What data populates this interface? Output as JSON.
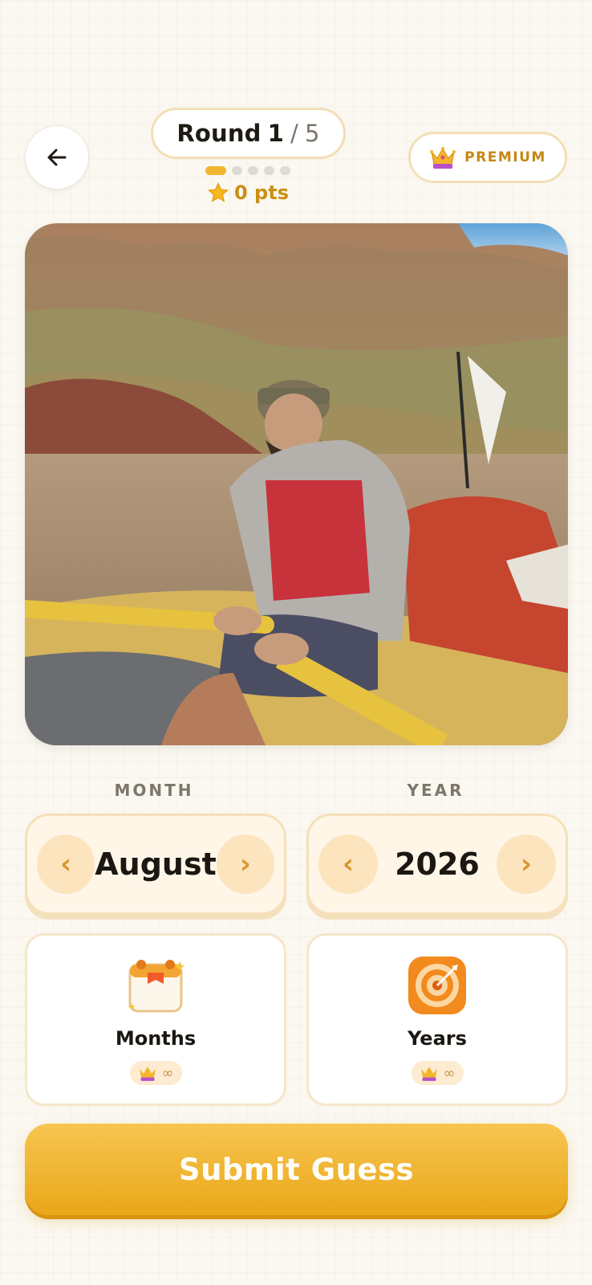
{
  "header": {
    "round_label": "Round",
    "round_current": "1",
    "round_separator": "/",
    "round_total": "5",
    "rounds_total_count": 5,
    "rounds_done": 1,
    "points": "0 pts",
    "premium_label": "PREMIUM"
  },
  "selectors": {
    "month": {
      "label": "MONTH",
      "value": "August",
      "prev": "‹",
      "next": "›"
    },
    "year": {
      "label": "YEAR",
      "value": "2026",
      "prev": "‹",
      "next": "›"
    }
  },
  "cards": {
    "months": {
      "title": "Months",
      "badge": "∞"
    },
    "years": {
      "title": "Years",
      "badge": "∞"
    }
  },
  "submit_label": "Submit Guess",
  "colors": {
    "accent": "#f1b52f",
    "accent_text": "#c98f14",
    "stepper_bg": "#fff6e8",
    "stepper_btn": "#fce4be"
  },
  "icons": {
    "back": "arrow-left-icon",
    "points": "star-icon",
    "premium": "crown-icon",
    "months_card": "calendar-icon",
    "years_card": "target-icon"
  }
}
